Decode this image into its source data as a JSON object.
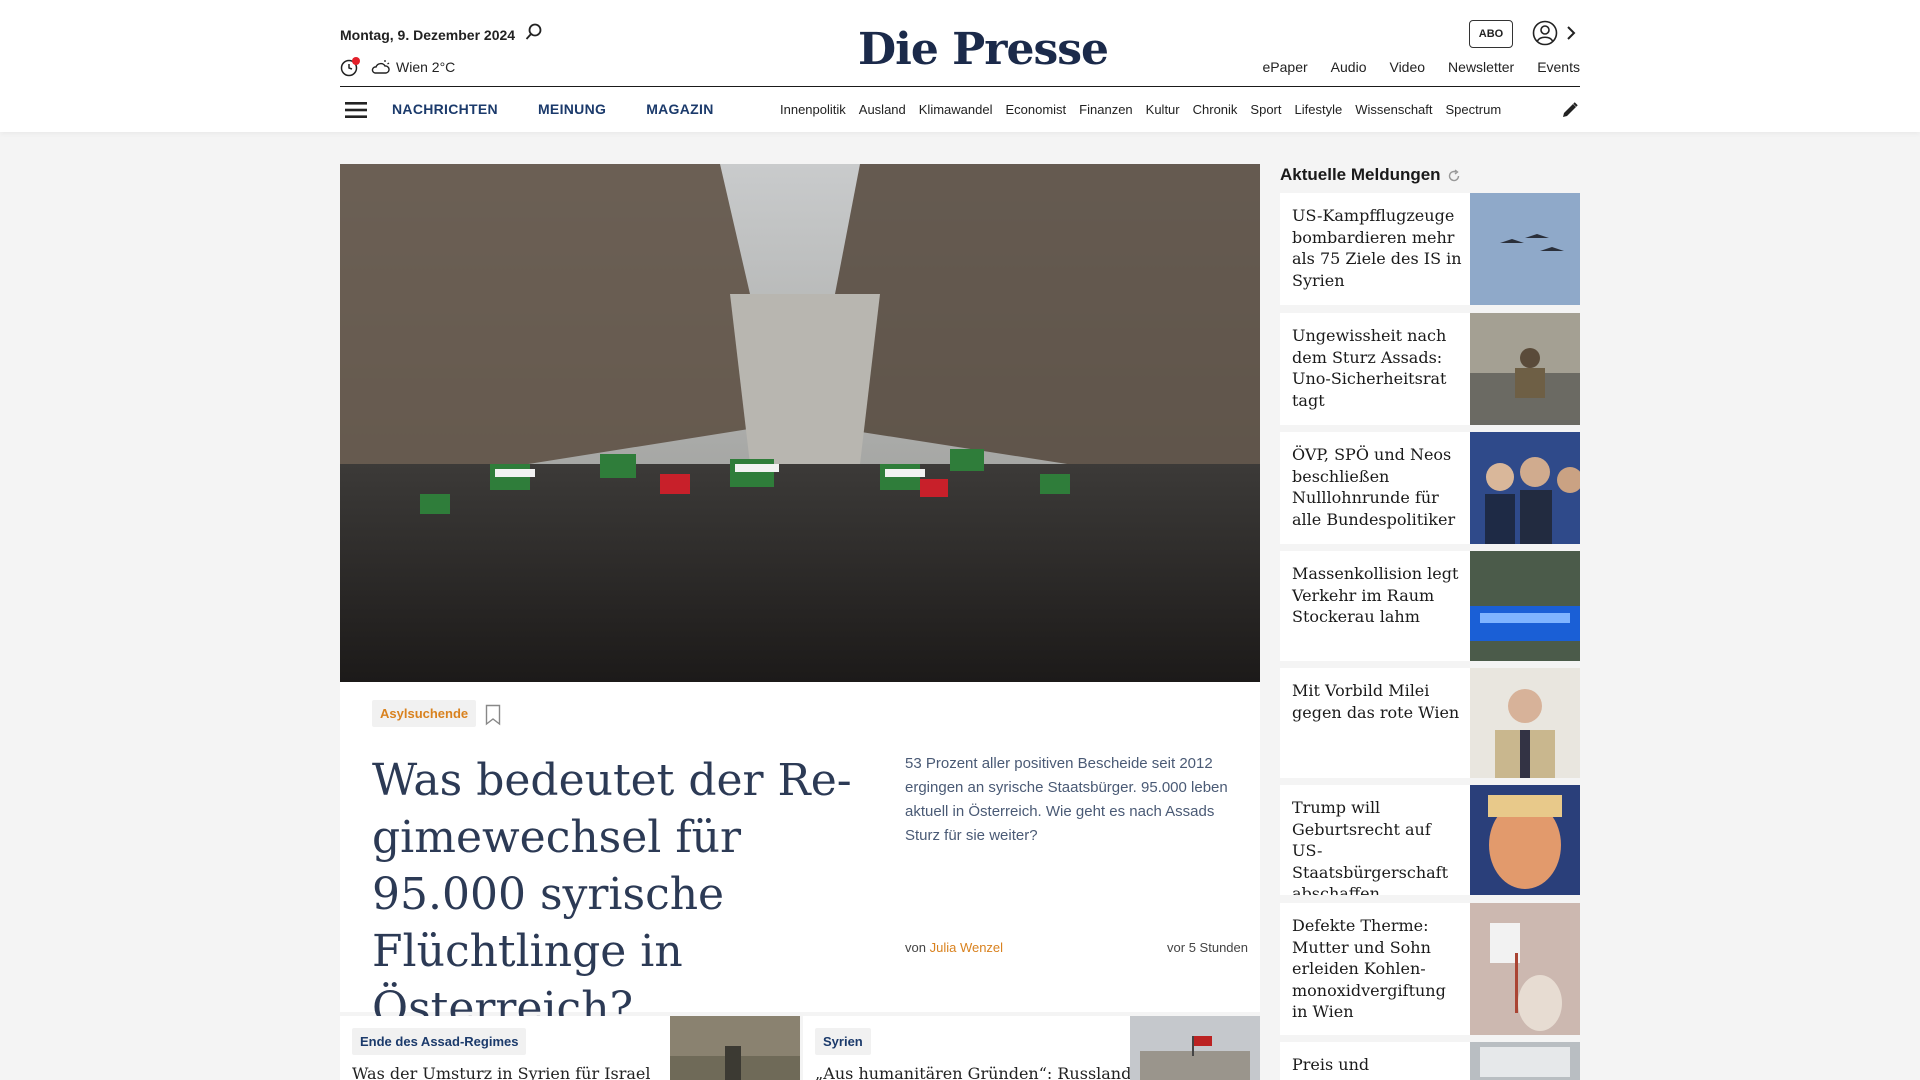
{
  "header": {
    "date": "Montag, 9. Dezember 2024",
    "weather": "Wien 2°C",
    "logo": "Die Presse",
    "abo_label": "ABO",
    "util_nav": [
      "ePaper",
      "Audio",
      "Video",
      "Newsletter",
      "Events"
    ],
    "main_nav": [
      "NACHRICHTEN",
      "MEINUNG",
      "MAGAZIN"
    ],
    "sub_nav": [
      "Innenpolitik",
      "Ausland",
      "Klimawandel",
      "Economist",
      "Finanzen",
      "Kultur",
      "Chronik",
      "Sport",
      "Lifestyle",
      "Wissenschaft",
      "Spectrum"
    ]
  },
  "hero": {
    "tag": "Asylsuchende",
    "title": "Was bedeutet der Re­gimewechsel für 95.000 syrische Flüchtlinge in Österreich?",
    "teaser": "53 Prozent aller positiven Bescheide seit 2012 ergingen an syrische Staatsbürger. 95.000 leben aktuell in Österreich. Wie geht es nach Assads Sturz für sie weiter?",
    "by_prefix": "von",
    "author": "Julia Wenzel",
    "time": "vor 5 Stunden"
  },
  "bottom_cards": [
    {
      "tag": "Ende des Assad-Regimes",
      "title": "Was der Umsturz in Syrien für Israel"
    },
    {
      "tag": "Syrien",
      "title": "„Aus humanitären Gründen“: Russland"
    }
  ],
  "sidebar": {
    "title": "Aktuelle Meldungen",
    "items": [
      {
        "text": "US-Kampfflugzeuge bombardieren mehr als 75 Ziele des IS in Syrien"
      },
      {
        "text": "Ungewissheit nach dem Sturz Assads: Uno-Sicherheitsrat tagt"
      },
      {
        "text": "ÖVP, SPÖ und Neos beschließen Nulllohnrunde für alle Bundespolitiker"
      },
      {
        "text": "Massenkollision legt Verkehr im Raum Stockerau lahm"
      },
      {
        "text": "Mit Vorbild Milei gegen das rote Wien"
      },
      {
        "text": "Trump will Geburtsrecht auf US-Staatsbürgerschaft abschaffen"
      },
      {
        "text": "Defekte Therme: Mutter und Sohn erleiden Kohlen­monoxidvergiftung in Wien"
      },
      {
        "text": "Preis und"
      }
    ]
  },
  "colors": {
    "brand_navy": "#1b2a4a",
    "nav_blue": "#1b3a6b",
    "accent_orange": "#d9821f",
    "alert_red": "#e3202a"
  },
  "icons": [
    "search-icon",
    "news-alert-icon",
    "weather-icon",
    "user-icon",
    "chevron-right-icon",
    "hamburger-icon",
    "edit-icon",
    "bookmark-icon",
    "refresh-icon"
  ]
}
